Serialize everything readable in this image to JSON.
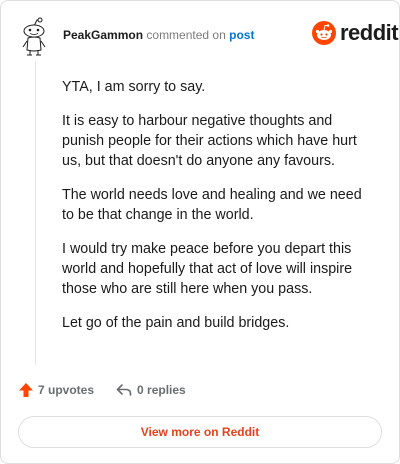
{
  "header": {
    "username": "PeakGammon",
    "action": "commented on",
    "target": "post"
  },
  "brand": {
    "name": "reddit",
    "accent": "#ff4500"
  },
  "comment": {
    "paragraphs": [
      "YTA, I am sorry to say.",
      "It is easy to harbour negative thoughts and punish people for their actions which have hurt us, but that doesn't do anyone any favours.",
      "The world needs love and healing and we need to be that change in the world.",
      "I would try make peace before you depart this world and hopefully that act of love will inspire those who are still here when you pass.",
      "Let go of the pain and build bridges."
    ]
  },
  "footer": {
    "upvotes": "7 upvotes",
    "replies": "0 replies",
    "upvote_icon": "upvote-arrow-icon",
    "reply_icon": "reply-arrow-icon",
    "upvote_color": "#ff4500"
  },
  "cta": {
    "label": "View more on Reddit",
    "color": "#e5411b"
  }
}
